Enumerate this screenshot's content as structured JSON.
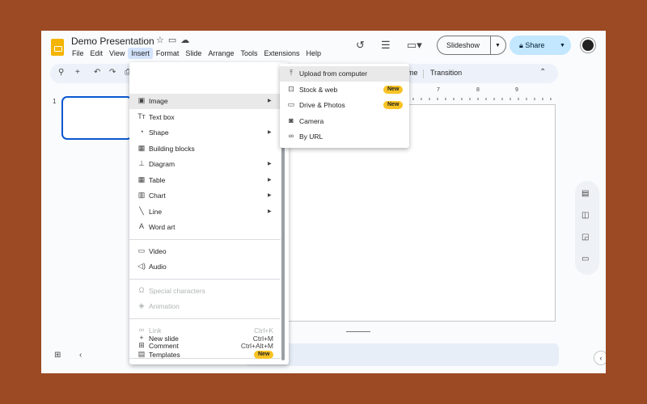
{
  "document": {
    "title": "Demo Presentation"
  },
  "menubar": {
    "items": [
      "File",
      "Edit",
      "View",
      "Insert",
      "Format",
      "Slide",
      "Arrange",
      "Tools",
      "Extensions",
      "Help"
    ]
  },
  "header": {
    "slideshow_label": "Slideshow",
    "share_label": "Share"
  },
  "toolbar": {
    "theme_label": "me",
    "transition_label": "Transition"
  },
  "ruler": {
    "marks": [
      "7",
      "8",
      "9"
    ]
  },
  "filmstrip": {
    "slide_number": "1"
  },
  "insert_menu": {
    "items": [
      {
        "label": "Image",
        "icon": "image-icon",
        "submenu": true
      },
      {
        "label": "Text box",
        "icon": "text-box-icon"
      },
      {
        "label": "Shape",
        "icon": "shape-icon",
        "submenu": true
      },
      {
        "label": "Building blocks",
        "icon": "building-blocks-icon"
      },
      {
        "label": "Diagram",
        "icon": "diagram-icon",
        "submenu": true
      },
      {
        "label": "Table",
        "icon": "table-icon",
        "submenu": true
      },
      {
        "label": "Chart",
        "icon": "chart-icon",
        "submenu": true
      },
      {
        "label": "Line",
        "icon": "line-icon",
        "submenu": true
      },
      {
        "label": "Word art",
        "icon": "word-art-icon"
      },
      {
        "label": "Video",
        "icon": "video-icon"
      },
      {
        "label": "Audio",
        "icon": "audio-icon"
      },
      {
        "label": "Special characters",
        "icon": "omega-icon",
        "disabled": true
      },
      {
        "label": "Animation",
        "icon": "animation-icon",
        "disabled": true
      },
      {
        "label": "Link",
        "icon": "link-icon",
        "disabled": true,
        "shortcut": "Ctrl+K"
      },
      {
        "label": "Comment",
        "icon": "comment-icon",
        "shortcut": "Ctrl+Alt+M"
      },
      {
        "label": "New slide",
        "icon": "plus-icon",
        "shortcut": "Ctrl+M"
      },
      {
        "label": "Templates",
        "icon": "templates-icon",
        "badge": "New"
      }
    ]
  },
  "image_submenu": {
    "items": [
      {
        "label": "Upload from computer",
        "icon": "upload-icon"
      },
      {
        "label": "Stock & web",
        "icon": "search-image-icon",
        "badge": "New"
      },
      {
        "label": "Drive & Photos",
        "icon": "folder-icon",
        "badge": "New"
      },
      {
        "label": "Camera",
        "icon": "camera-icon"
      },
      {
        "label": "By URL",
        "icon": "link-icon"
      }
    ]
  },
  "colors": {
    "accent": "#0b57d0",
    "badge": "#f8c324",
    "share": "#c2e7ff",
    "backdrop": "#9c4a24",
    "logo": "#f4b400"
  }
}
